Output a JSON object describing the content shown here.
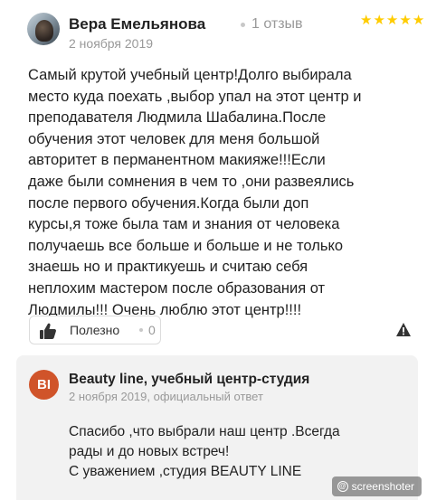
{
  "review": {
    "author": "Вера Емельянова",
    "reviews_count": "1 отзыв",
    "rating": 5,
    "date": "2 ноября 2019",
    "text_lines": [
      "Самый крутой учебный центр!Долго выбирала",
      "место куда поехать ,выбор упал на этот центр и",
      "преподавателя Людмила Шабалина.После",
      "обучения этот человек для меня большой",
      "авторитет в перманентном макияже!!!Если",
      "даже были сомнения в чем то ,они развеялись",
      "после первого обучения.Когда были доп",
      "курсы,я тоже была там и знания от человека",
      "получаешь все больше и больше и не только",
      "знаешь но и практикуешь и считаю себя",
      "неплохим мастером после образования от",
      "Людмилы!!! Очень люблю этот центр!!!!"
    ],
    "like_label": "Полезно",
    "like_count": "0"
  },
  "reply": {
    "avatar_initials": "BI",
    "avatar_color": "#d0542a",
    "author": "Beauty line, учебный центр-студия",
    "meta": "2 ноября 2019, официальный ответ",
    "text_lines": [
      "Спасибо ,что выбрали наш центр .Всегда",
      "рады и до новых встреч!",
      "С уважением ,студия BEAUTY LINE"
    ]
  },
  "watermark": {
    "text": "screenshoter"
  },
  "colors": {
    "star": "#ffcc00",
    "muted": "#999999",
    "reply_background": "#f2f2f2"
  }
}
